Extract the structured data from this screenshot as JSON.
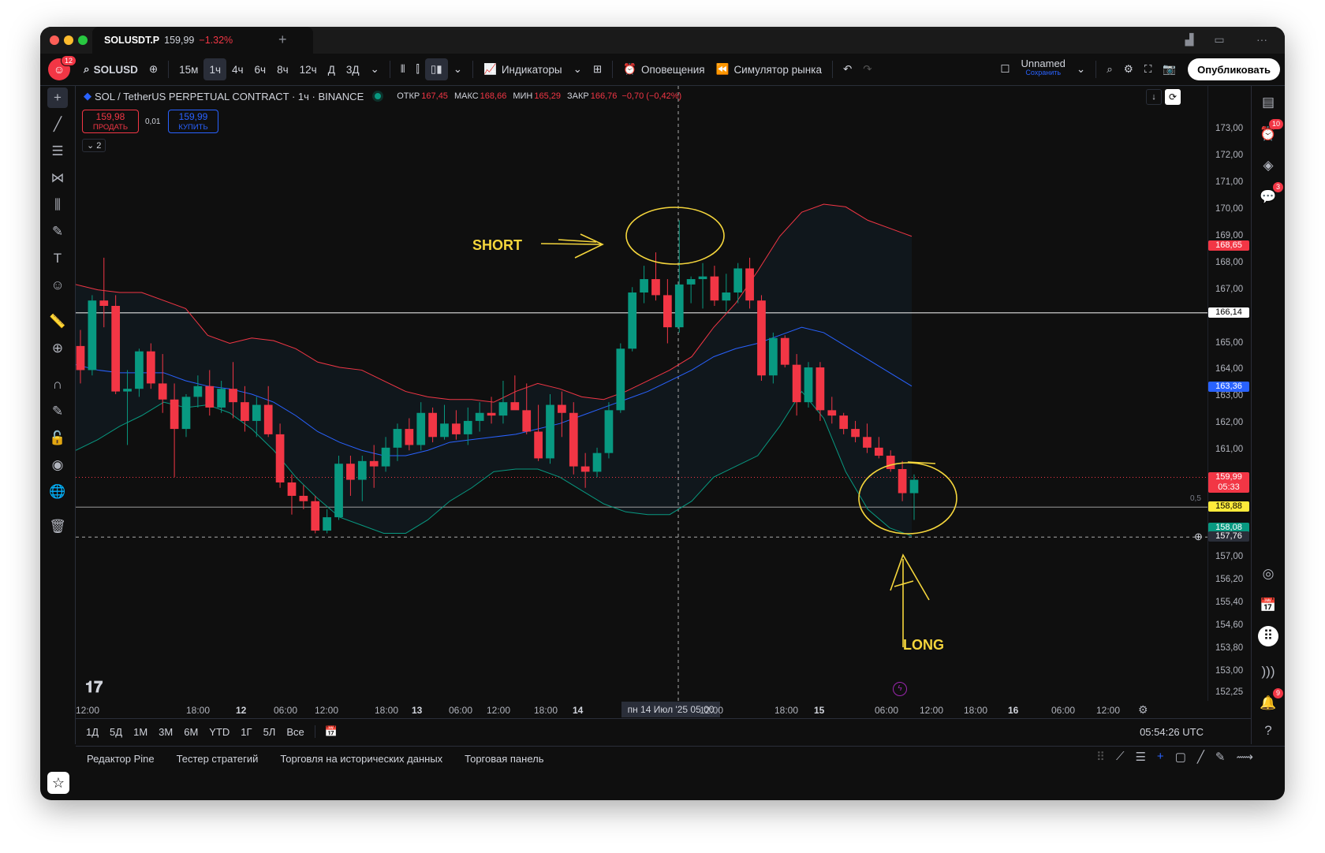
{
  "window": {
    "tab_symbol": "SOLUSDT.P",
    "tab_price": "159,99",
    "tab_change": "−1.32%"
  },
  "toolbar": {
    "avatar_badge": "12",
    "symbol": "SOLUSD",
    "intervals": [
      "15м",
      "1ч",
      "4ч",
      "6ч",
      "8ч",
      "12ч",
      "Д",
      "3Д"
    ],
    "active_interval": "1ч",
    "indicators": "Индикаторы",
    "alerts": "Оповещения",
    "replay": "Симулятор рынка",
    "layout_name": "Unnamed",
    "layout_save": "Сохранить",
    "publish": "Опубликовать"
  },
  "legend": {
    "title": "SOL / TetherUS PERPETUAL CONTRACT · 1ч · BINANCE",
    "open_label": "ОТКР",
    "open": "167,45",
    "high_label": "МАКС",
    "high": "168,66",
    "low_label": "МИН",
    "low": "165,29",
    "close_label": "ЗАКР",
    "close": "166,76",
    "change": "−0,70 (−0,42%)"
  },
  "trade": {
    "sell_price": "159,98",
    "sell_label": "ПРОДАТЬ",
    "spread": "0,01",
    "buy_price": "159,99",
    "buy_label": "КУПИТЬ",
    "collapse_count": "2"
  },
  "price_scale": {
    "ticks": [
      "173,00",
      "172,00",
      "171,00",
      "170,00",
      "169,00",
      "168,00",
      "167,00",
      "165,00",
      "164,00",
      "163,00",
      "162,00",
      "161,00",
      "157,00",
      "156,20",
      "155,40",
      "154,60",
      "153,80",
      "153,00",
      "152,25"
    ],
    "tags": {
      "upper_band": "168,65",
      "hline": "166,14",
      "basis": "163,36",
      "last_price": "159,99",
      "countdown": "05:33",
      "level": "158,88",
      "level_ratio": "0,5",
      "lower_band": "158,08",
      "crosshair": "157,76"
    }
  },
  "time_axis": {
    "labels": [
      "12:00",
      "18:00",
      "12",
      "06:00",
      "12:00",
      "18:00",
      "13",
      "06:00",
      "12:00",
      "18:00",
      "14",
      "12:00",
      "18:00",
      "15",
      "06:00",
      "12:00",
      "18:00",
      "16",
      "06:00",
      "12:00"
    ],
    "crosshair_label": "пн 14 Июл '25   05:00"
  },
  "range_bar": {
    "ranges": [
      "1Д",
      "5Д",
      "1М",
      "3М",
      "6М",
      "YTD",
      "1Г",
      "5Л",
      "Все"
    ],
    "clock": "05:54:26 UTC"
  },
  "bottom_tabs": [
    "Редактор Pine",
    "Тестер стратегий",
    "Торговля на исторических данных",
    "Торговая панель"
  ],
  "annotations": {
    "short": "SHORT",
    "long": "LONG"
  },
  "right_toolbar": {
    "alerts_badge": "10",
    "chat_badge": "3",
    "notif_badge": "9"
  },
  "chart_data": {
    "type": "candlestick",
    "symbol": "SOL / TetherUS PERPETUAL CONTRACT",
    "interval": "1ч",
    "exchange": "BINANCE",
    "colors": {
      "up": "#089981",
      "down": "#f23645",
      "upper_band": "#f23645",
      "basis": "#2962ff",
      "lower_band": "#089981"
    },
    "candles": [
      [
        164.9,
        165.5,
        163.5,
        164.0
      ],
      [
        164.0,
        166.8,
        163.8,
        166.6
      ],
      [
        166.6,
        168.2,
        165.6,
        166.4
      ],
      [
        166.4,
        166.8,
        163.1,
        163.2
      ],
      [
        163.2,
        164.0,
        161.2,
        163.3
      ],
      [
        163.3,
        164.8,
        163.0,
        164.7
      ],
      [
        164.7,
        165.0,
        163.3,
        163.5
      ],
      [
        163.5,
        164.6,
        162.4,
        162.9
      ],
      [
        162.9,
        163.5,
        160.0,
        161.8
      ],
      [
        161.8,
        163.1,
        161.5,
        163.0
      ],
      [
        163.0,
        163.8,
        162.6,
        163.4
      ],
      [
        163.4,
        164.0,
        162.3,
        162.6
      ],
      [
        162.6,
        163.6,
        162.4,
        163.3
      ],
      [
        163.3,
        164.3,
        162.2,
        162.8
      ],
      [
        162.8,
        163.4,
        161.7,
        162.1
      ],
      [
        162.1,
        163.0,
        161.5,
        162.7
      ],
      [
        162.7,
        163.4,
        161.5,
        161.6
      ],
      [
        161.6,
        162.0,
        159.6,
        159.8
      ],
      [
        159.8,
        160.1,
        158.6,
        159.3
      ],
      [
        159.3,
        159.7,
        158.8,
        159.1
      ],
      [
        159.1,
        159.3,
        157.9,
        158.0
      ],
      [
        158.0,
        158.8,
        157.9,
        158.5
      ],
      [
        158.5,
        160.8,
        158.4,
        160.5
      ],
      [
        160.5,
        160.8,
        159.3,
        159.9
      ],
      [
        159.9,
        160.8,
        159.1,
        160.6
      ],
      [
        160.6,
        161.2,
        159.6,
        160.4
      ],
      [
        160.4,
        161.5,
        160.2,
        161.1
      ],
      [
        161.1,
        162.0,
        160.6,
        161.8
      ],
      [
        161.8,
        162.2,
        161.0,
        161.2
      ],
      [
        161.2,
        162.8,
        161.0,
        162.4
      ],
      [
        162.4,
        162.6,
        161.3,
        161.5
      ],
      [
        161.5,
        162.7,
        161.4,
        162.0
      ],
      [
        162.0,
        162.5,
        161.4,
        161.6
      ],
      [
        161.6,
        162.6,
        161.2,
        162.1
      ],
      [
        162.1,
        162.8,
        161.7,
        162.4
      ],
      [
        162.4,
        163.0,
        162.0,
        162.3
      ],
      [
        162.3,
        163.6,
        162.0,
        162.8
      ],
      [
        162.8,
        163.8,
        162.6,
        162.5
      ],
      [
        162.5,
        163.5,
        161.6,
        161.7
      ],
      [
        161.7,
        162.7,
        160.6,
        160.7
      ],
      [
        160.7,
        163.1,
        160.5,
        162.7
      ],
      [
        162.7,
        163.2,
        161.5,
        162.4
      ],
      [
        162.4,
        162.8,
        160.1,
        160.4
      ],
      [
        160.4,
        160.9,
        159.6,
        160.2
      ],
      [
        160.2,
        161.1,
        160.0,
        160.9
      ],
      [
        160.9,
        162.8,
        160.7,
        162.5
      ],
      [
        162.5,
        165.0,
        162.4,
        164.8
      ],
      [
        164.8,
        167.1,
        164.7,
        166.9
      ],
      [
        166.9,
        167.9,
        166.5,
        167.4
      ],
      [
        167.4,
        168.4,
        166.6,
        166.8
      ],
      [
        166.8,
        167.4,
        165.0,
        165.6
      ],
      [
        165.6,
        169.6,
        165.4,
        167.2
      ],
      [
        167.2,
        167.5,
        166.5,
        167.4
      ],
      [
        167.4,
        168.0,
        166.3,
        167.5
      ],
      [
        167.5,
        167.9,
        166.4,
        166.6
      ],
      [
        166.6,
        167.6,
        166.2,
        166.9
      ],
      [
        166.9,
        168.0,
        166.5,
        167.8
      ],
      [
        167.8,
        168.2,
        166.3,
        166.6
      ],
      [
        166.6,
        166.8,
        163.6,
        163.8
      ],
      [
        163.8,
        165.4,
        163.5,
        165.2
      ],
      [
        165.2,
        165.3,
        164.1,
        164.2
      ],
      [
        164.2,
        164.6,
        162.3,
        162.8
      ],
      [
        162.8,
        164.3,
        162.6,
        164.1
      ],
      [
        164.1,
        164.3,
        162.1,
        162.5
      ],
      [
        162.5,
        163.0,
        162.0,
        162.3
      ],
      [
        162.3,
        162.4,
        161.6,
        161.8
      ],
      [
        161.8,
        162.1,
        161.3,
        161.5
      ],
      [
        161.5,
        162.0,
        160.9,
        161.1
      ],
      [
        161.1,
        161.5,
        160.7,
        160.8
      ],
      [
        160.8,
        161.0,
        160.2,
        160.3
      ],
      [
        160.3,
        160.6,
        159.1,
        159.4
      ],
      [
        159.4,
        160.1,
        158.4,
        159.9
      ]
    ],
    "bollinger": {
      "upper": [
        167.2,
        167.0,
        166.9,
        166.9,
        166.6,
        166.3,
        165.3,
        165.0,
        165.2,
        165.1,
        164.8,
        164.3,
        164.1,
        164.0,
        163.6,
        163.2,
        163.0,
        162.9,
        162.9,
        162.8,
        163.2,
        163.5,
        163.3,
        163.0,
        162.9,
        163.2,
        163.6,
        164.0,
        164.5,
        165.6,
        166.5,
        167.7,
        169.0,
        169.9,
        170.2,
        170.1,
        169.6,
        169.3,
        169.0
      ],
      "basis": [
        164.2,
        164.0,
        163.9,
        163.9,
        163.9,
        163.6,
        163.4,
        163.3,
        163.1,
        162.8,
        162.3,
        161.7,
        161.3,
        161.0,
        160.8,
        160.8,
        161.0,
        161.3,
        161.4,
        161.5,
        161.6,
        161.8,
        162.0,
        162.3,
        162.6,
        162.9,
        163.2,
        163.6,
        164.0,
        164.5,
        164.8,
        165.0,
        165.3,
        165.6,
        165.4,
        164.9,
        164.4,
        163.9,
        163.4
      ],
      "lower": [
        161.0,
        161.4,
        161.9,
        162.3,
        162.8,
        162.6,
        162.7,
        162.4,
        161.8,
        161.0,
        160.0,
        159.2,
        158.5,
        158.2,
        157.9,
        157.9,
        158.4,
        159.1,
        159.6,
        160.2,
        160.3,
        160.3,
        160.0,
        159.5,
        159.0,
        158.7,
        158.6,
        158.6,
        159.1,
        160.0,
        160.4,
        160.8,
        161.9,
        163.2,
        162.2,
        160.2,
        158.8,
        158.1,
        157.8
      ]
    },
    "horizontal_lines": [
      166.14,
      158.88
    ],
    "crosshair_price": 157.76,
    "last_price": 159.99,
    "ylim": [
      151.8,
      173.3
    ]
  }
}
